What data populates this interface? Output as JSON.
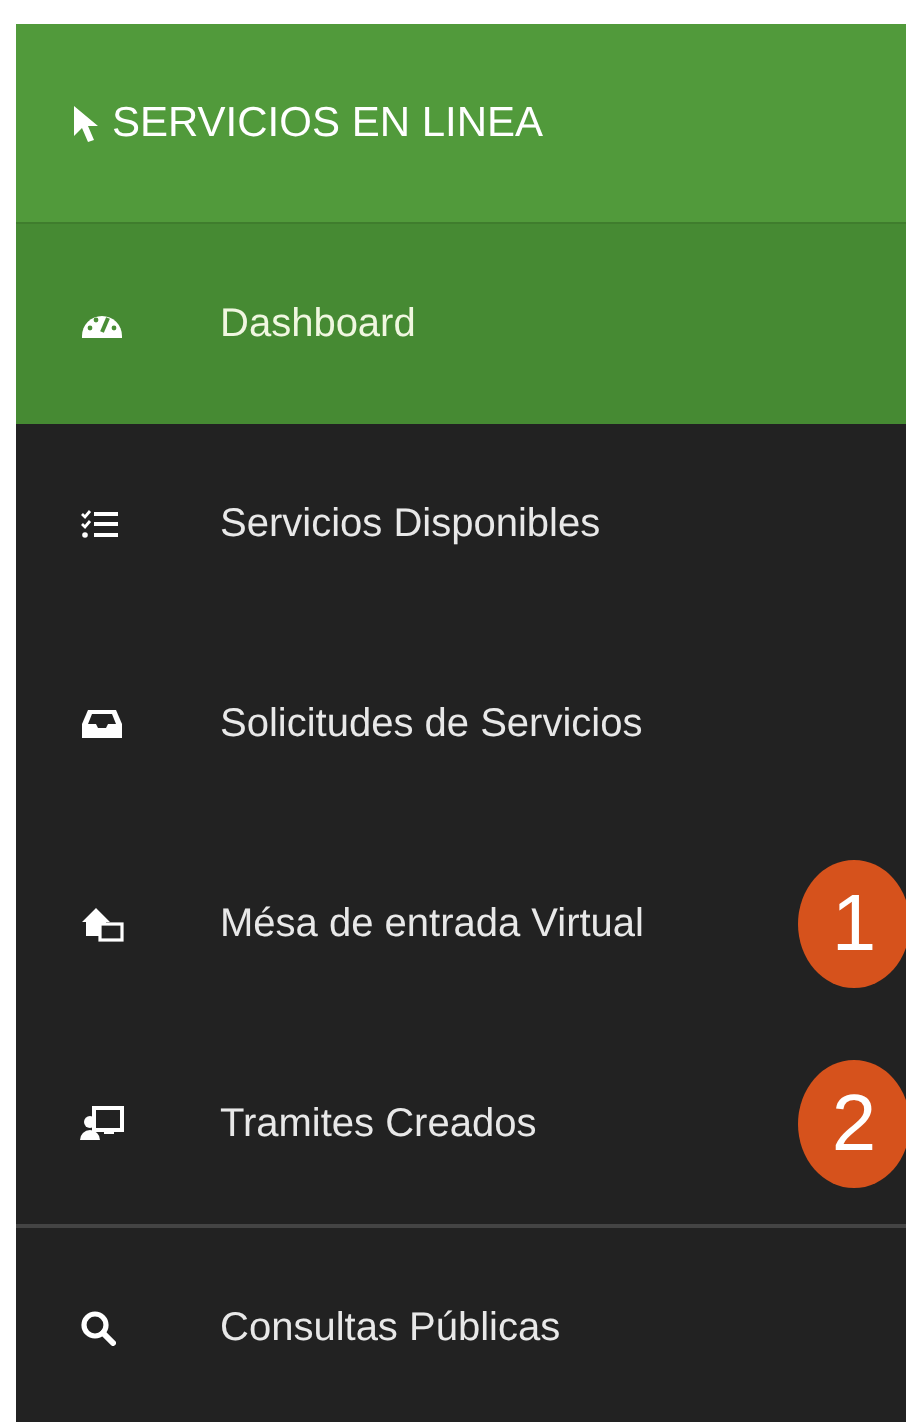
{
  "header": {
    "title": "SERVICIOS EN LINEA"
  },
  "menu": [
    {
      "label": "Dashboard",
      "selected": true
    },
    {
      "label": "Servicios Disponibles",
      "selected": false
    },
    {
      "label": "Solicitudes de Servicios",
      "selected": false
    },
    {
      "label": "Mésa de entrada Virtual",
      "selected": false,
      "badge": "1"
    },
    {
      "label": "Tramites Creados",
      "selected": false,
      "badge": "2"
    },
    {
      "label": "Consultas Públicas",
      "selected": false,
      "divider_above": true
    }
  ]
}
